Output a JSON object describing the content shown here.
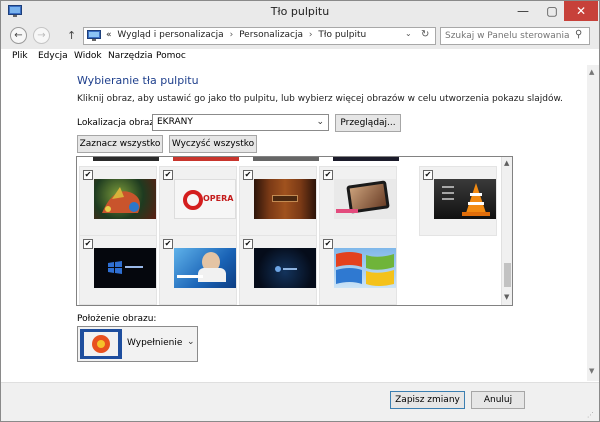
{
  "window": {
    "title": "Tło pulpitu",
    "min": "—",
    "max": "▢",
    "close": "✕"
  },
  "address": {
    "crumbs_prefix": "«",
    "crumbs": [
      "Wygląd i personalizacja",
      "Personalizacja",
      "Tło pulpitu"
    ],
    "separator": "›",
    "dropdown": "⌄",
    "refresh": "↻"
  },
  "search": {
    "placeholder": "Szukaj w Panelu sterowania",
    "icon": "⚲"
  },
  "nav": {
    "back": "←",
    "forward": "→",
    "up": "↑"
  },
  "menu": [
    "Plik",
    "Edycja",
    "Widok",
    "Narzędzia",
    "Pomoc"
  ],
  "page": {
    "heading": "Wybieranie tła pulpitu",
    "description": "Kliknij obraz, aby ustawić go jako tło pulpitu, lub wybierz więcej obrazów w celu utworzenia pokazu slajdów.",
    "location_label": "Lokalizacja obrazu:",
    "location_value": "EKRANY",
    "browse_label": "Przeglądaj...",
    "select_all_label": "Zaznacz wszystko",
    "clear_all_label": "Wyczyść wszystko",
    "position_label": "Położenie obrazu:",
    "position_value": "Wypełnienie"
  },
  "gallery": [
    {
      "checked": true,
      "caption": "",
      "kind": "dragon"
    },
    {
      "checked": true,
      "caption": "OPERA",
      "kind": "opera"
    },
    {
      "checked": true,
      "caption": "",
      "kind": "wood"
    },
    {
      "checked": true,
      "caption": "",
      "kind": "tablet"
    },
    {
      "checked": true,
      "caption": "",
      "kind": "vlc"
    },
    {
      "checked": true,
      "caption": "",
      "kind": "win8"
    },
    {
      "checked": true,
      "caption": "",
      "kind": "win7"
    },
    {
      "checked": true,
      "caption": "",
      "kind": "darkblue"
    },
    {
      "checked": true,
      "caption": "",
      "kind": "xp"
    }
  ],
  "checkmark": "✔",
  "scroll": {
    "up": "▲",
    "down": "▼"
  },
  "footer": {
    "save_label": "Zapisz zmiany",
    "cancel_label": "Anuluj"
  },
  "grip": "⋰",
  "colors": {
    "accent": "#1e3f8c",
    "close_button": "#c7413a",
    "primary_border": "#3c7fb1"
  }
}
